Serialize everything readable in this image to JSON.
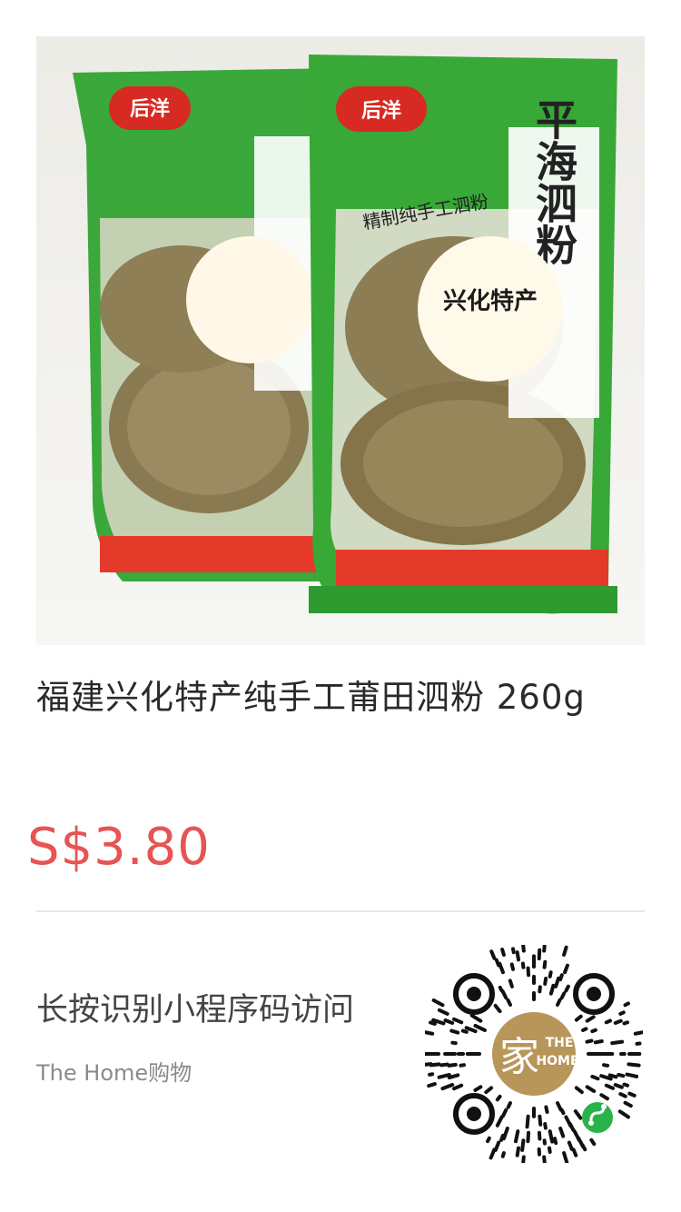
{
  "product": {
    "image_icon": "rice-noodle-package-image",
    "package_brand": "后洋",
    "package_name": "平海泗粉",
    "package_tagline": "精制纯手工泗粉",
    "package_badge": "兴化特产",
    "title": "福建兴化特产纯手工莆田泗粉  260g",
    "price": "S$3.80"
  },
  "miniprogram": {
    "scan_hint": "长按识别小程序码访问",
    "store_name": "The Home购物",
    "qr_icon": "mini-program-code-icon",
    "logo_line1": "THE",
    "logo_line2": "HOME"
  },
  "colors": {
    "price": "#e85353",
    "package_green": "#3aa83a",
    "logo_gold": "#b8965a"
  }
}
